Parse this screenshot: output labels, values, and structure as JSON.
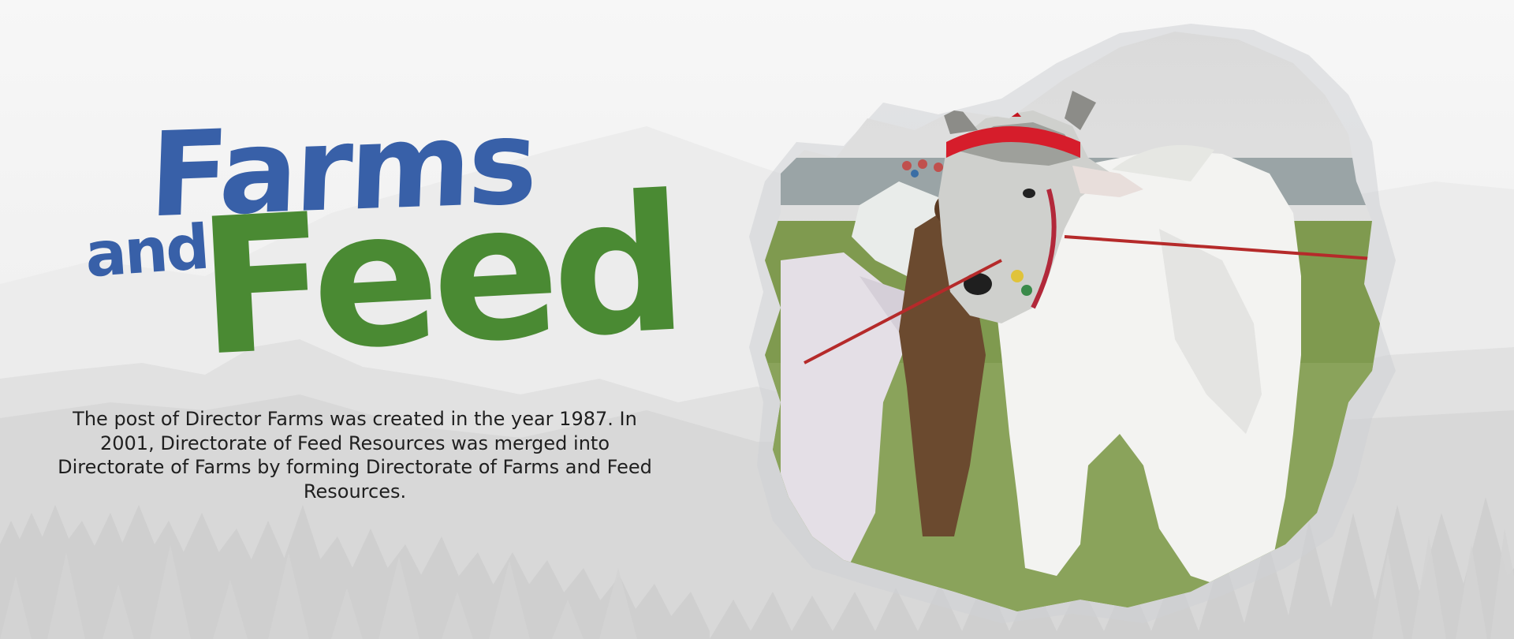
{
  "banner": {
    "title_line1": "Farms",
    "title_line2": "and",
    "title_line3": "Feed",
    "description": "The post of Director Farms was created in the year 1987. In 2001, Directorate of Feed Resources was merged into Directorate of Farms by forming Directorate of Farms and Feed Resources."
  },
  "colors": {
    "title_blue": "#3860a8",
    "title_green": "#4a8a33",
    "text": "#1f1f1f",
    "background": "#f2f2f2"
  },
  "photo": {
    "subject": "white zebu bull with red headband at livestock show"
  }
}
